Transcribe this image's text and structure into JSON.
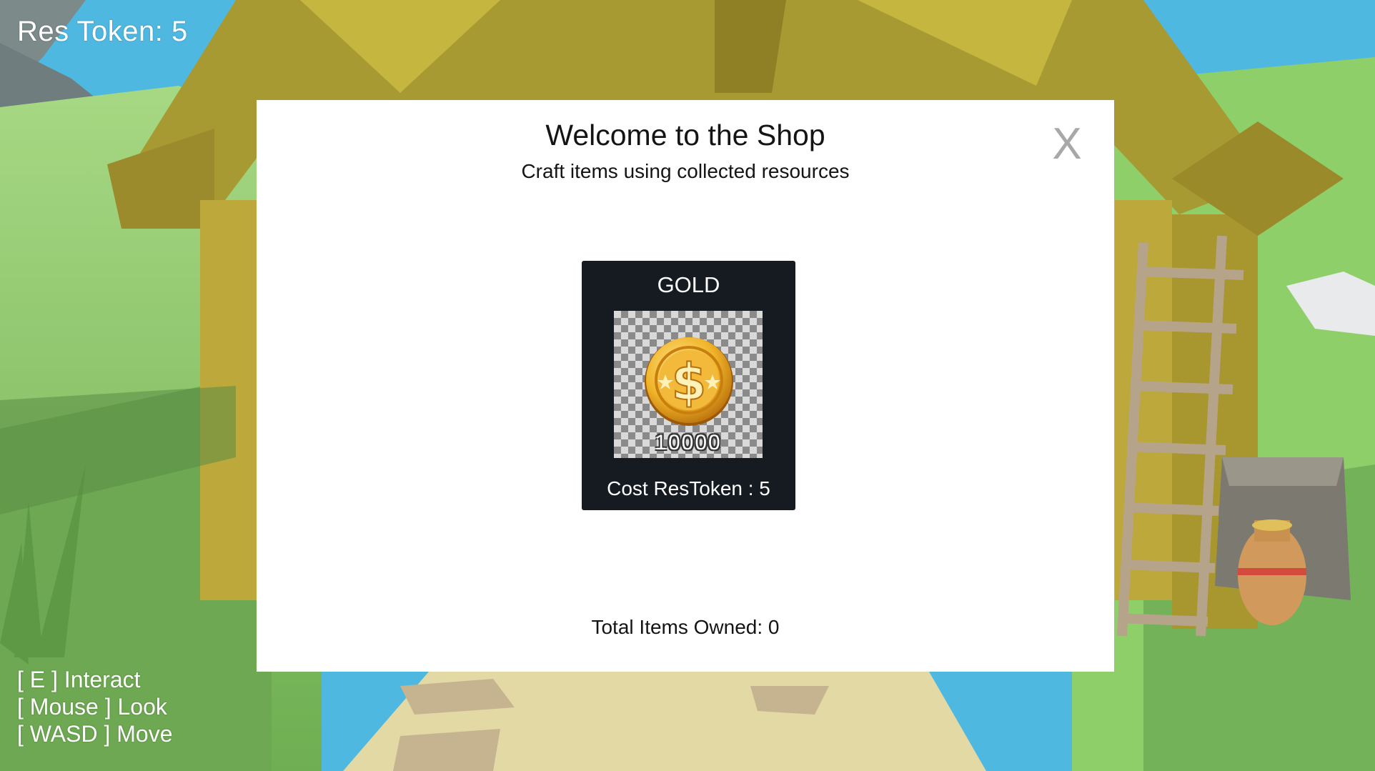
{
  "hud": {
    "res_token": "Res Token: 5",
    "controls": [
      "[ E ] Interact",
      "[ Mouse ] Look",
      "[ WASD ] Move"
    ]
  },
  "shop": {
    "title": "Welcome to the Shop",
    "subtitle": "Craft items using collected resources",
    "close_label": "X",
    "items": [
      {
        "name": "GOLD",
        "amount": "10000",
        "icon": "gold-coin-dollar-icon",
        "cost": "Cost ResToken : 5"
      }
    ],
    "total_owned": "Total Items Owned: 0"
  },
  "colors": {
    "sky": "#4fb8e0",
    "grass": "#8cc66a",
    "wood": "#a89a33",
    "modal_bg": "#ffffff",
    "card_bg": "#161b22",
    "close_grey": "#a8a8a8",
    "gold": "#f0b429"
  }
}
